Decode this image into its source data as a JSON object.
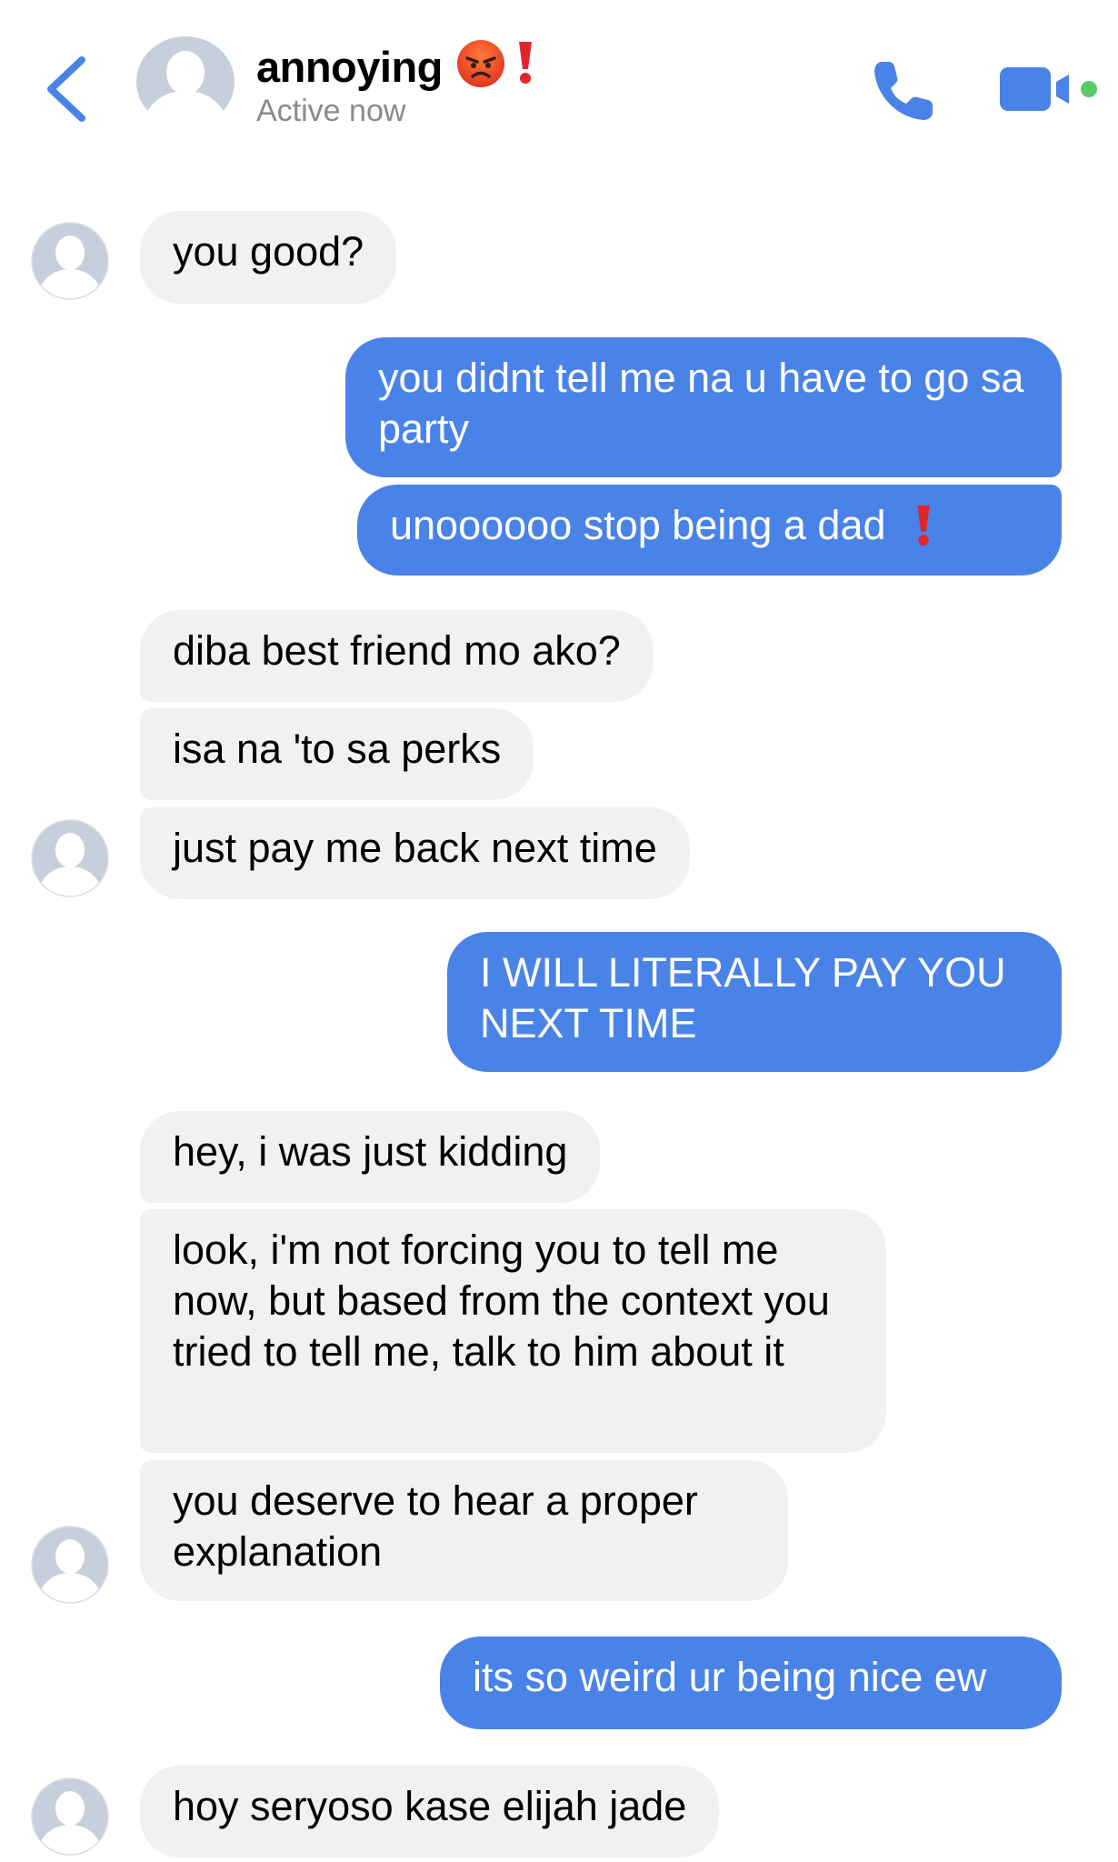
{
  "header": {
    "contact_name": "annoying",
    "status": "Active now",
    "icons": [
      "back-chevron-icon",
      "contact-avatar",
      "angry-face-emoji",
      "red-exclamation-emoji",
      "phone-icon",
      "video-camera-icon",
      "online-dot"
    ]
  },
  "messages": [
    {
      "from": "them",
      "text": "you good?"
    },
    {
      "from": "me",
      "text": "you didnt tell me na u have to go sa party"
    },
    {
      "from": "me",
      "text": "unoooooo stop being a dad"
    },
    {
      "from": "them",
      "text": "diba best friend mo ako?"
    },
    {
      "from": "them",
      "text": "isa na 'to sa perks"
    },
    {
      "from": "them",
      "text": "just pay me back next time"
    },
    {
      "from": "me",
      "text": "I WILL LITERALLY PAY YOU NEXT TIME"
    },
    {
      "from": "them",
      "text": "hey, i was just kidding"
    },
    {
      "from": "them",
      "text": "look, i'm not forcing you to tell me now, but based from the context you tried to tell me, talk to him about it"
    },
    {
      "from": "them",
      "text": "you deserve to hear a proper explanation"
    },
    {
      "from": "me",
      "text": "its so weird ur being nice ew"
    },
    {
      "from": "them",
      "text": "hoy seryoso kase elijah jade"
    }
  ],
  "colors": {
    "accent": "#4a83e8",
    "incoming_bubble": "#f1f1f2",
    "active_dot": "#5ac96a",
    "emoji_red": "#e0262b",
    "avatar_placeholder": "#c8cfdc"
  }
}
